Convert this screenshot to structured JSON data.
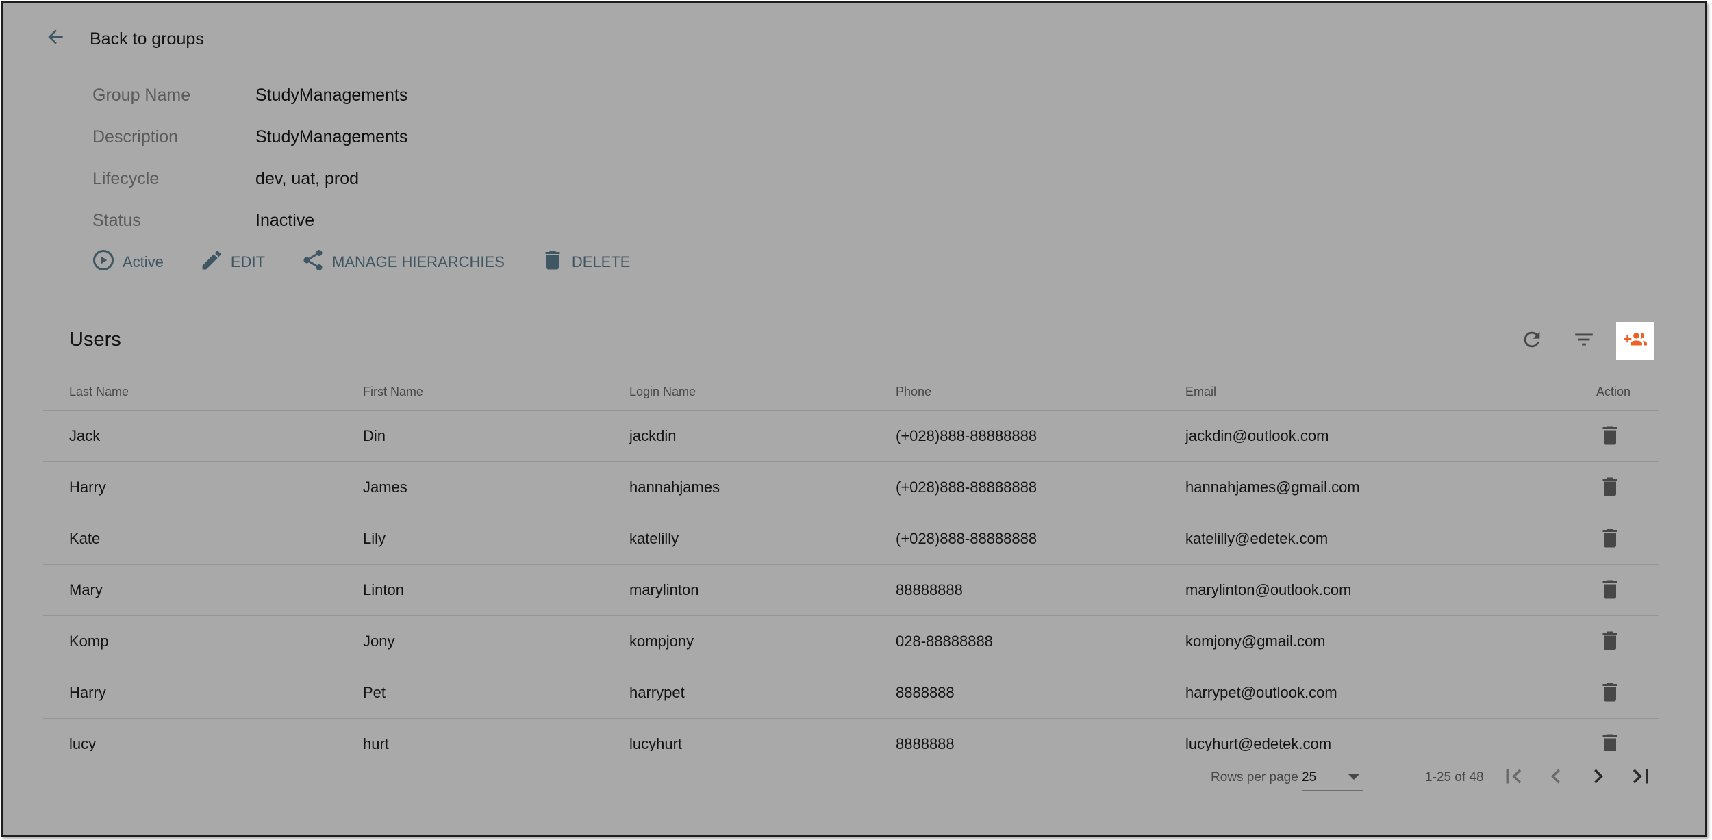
{
  "back": {
    "label": "Back to groups",
    "icon": "arrow-back-icon"
  },
  "group": {
    "fields": [
      {
        "label": "Group Name",
        "value": "StudyManagements"
      },
      {
        "label": "Description",
        "value": "StudyManagements"
      },
      {
        "label": "Lifecycle",
        "value": "dev, uat, prod"
      },
      {
        "label": "Status",
        "value": "Inactive"
      }
    ]
  },
  "actions": {
    "active": "Active",
    "edit": "EDIT",
    "manage": "MANAGE HIERARCHIES",
    "delete": "DELETE"
  },
  "users": {
    "title": "Users",
    "columns": [
      "Last Name",
      "First Name",
      "Login Name",
      "Phone",
      "Email",
      "Action"
    ],
    "rows": [
      [
        "Jack",
        "Din",
        "jackdin",
        "(+028)888-88888888",
        "jackdin@outlook.com"
      ],
      [
        "Harry",
        "James",
        "hannahjames",
        "(+028)888-88888888",
        "hannahjames@gmail.com"
      ],
      [
        "Kate",
        "Lily",
        "katelilly",
        "(+028)888-88888888",
        "katelilly@edetek.com"
      ],
      [
        "Mary",
        "Linton",
        "marylinton",
        "88888888",
        "marylinton@outlook.com"
      ],
      [
        "Komp",
        "Jony",
        "kompjony",
        "028-88888888",
        "komjony@gmail.com"
      ],
      [
        "Harry",
        "Pet",
        "harrypet",
        "8888888",
        "harrypet@outlook.com"
      ],
      [
        "lucy",
        "hurt",
        "lucyhurt",
        "8888888",
        "lucyhurt@edetek.com"
      ]
    ]
  },
  "pagination": {
    "rows_per_page_label": "Rows per page",
    "rows_per_page_value": "25",
    "range": "1-25 of 48"
  },
  "colors": {
    "overlay": "#a9a9a9",
    "accent": "#e8622a",
    "action_text": "#3f5663"
  }
}
